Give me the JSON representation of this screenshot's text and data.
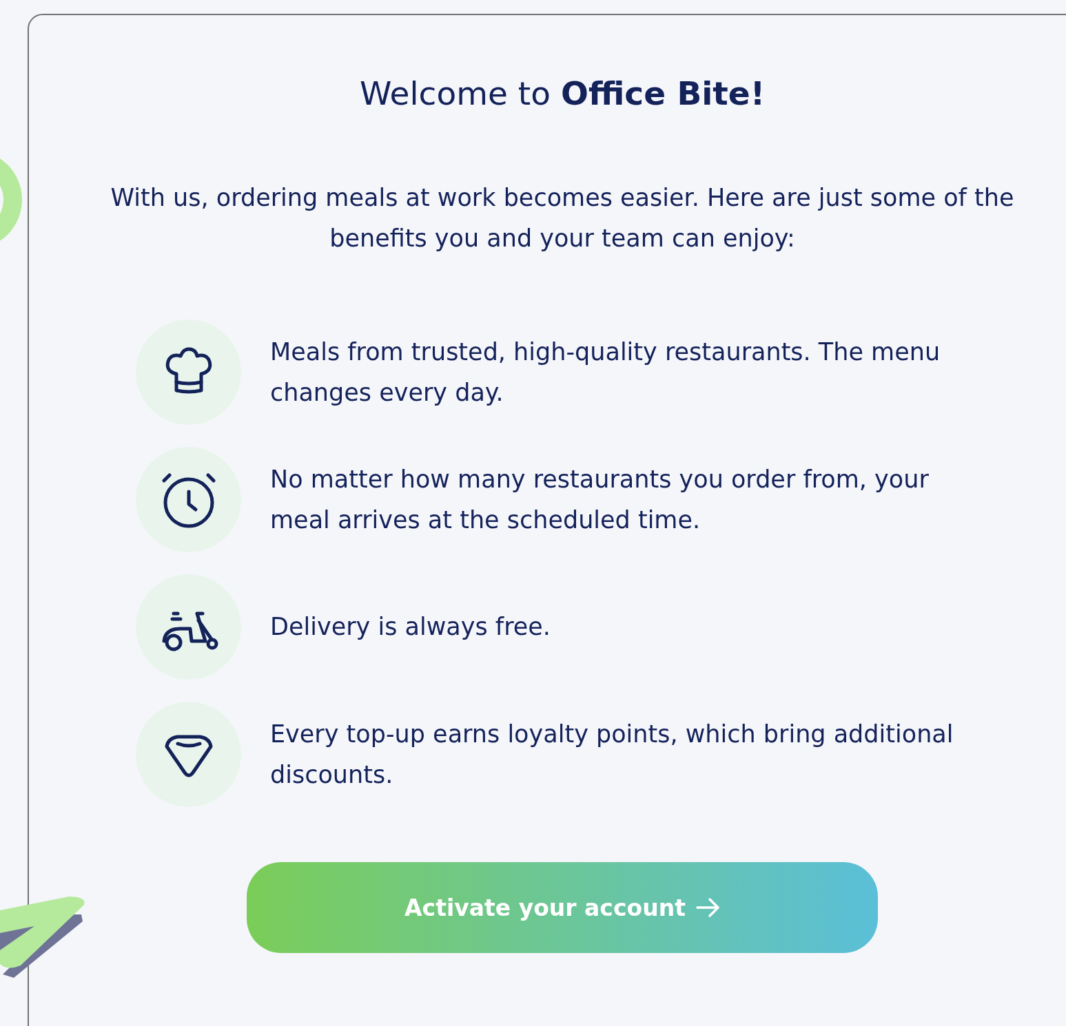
{
  "title": "Welcome to **Office Bite!**",
  "intro": "With us, ordering meals at work becomes easier. Here are just some of the benefits you and your team can enjoy:",
  "benefits": [
    {
      "kind": "chef-hat",
      "text": "Meals from trusted, high-quality restaurants. The menu changes every day."
    },
    {
      "kind": "alarm-clock",
      "text": "No matter how many restaurants you order from, your meal arrives at the scheduled time."
    },
    {
      "kind": "scooter",
      "text": "Delivery is always free."
    },
    {
      "kind": "diamond",
      "text": "Every top-up earns loyalty points, which bring additional discounts."
    }
  ],
  "button": {
    "label": "Activate your account"
  }
}
